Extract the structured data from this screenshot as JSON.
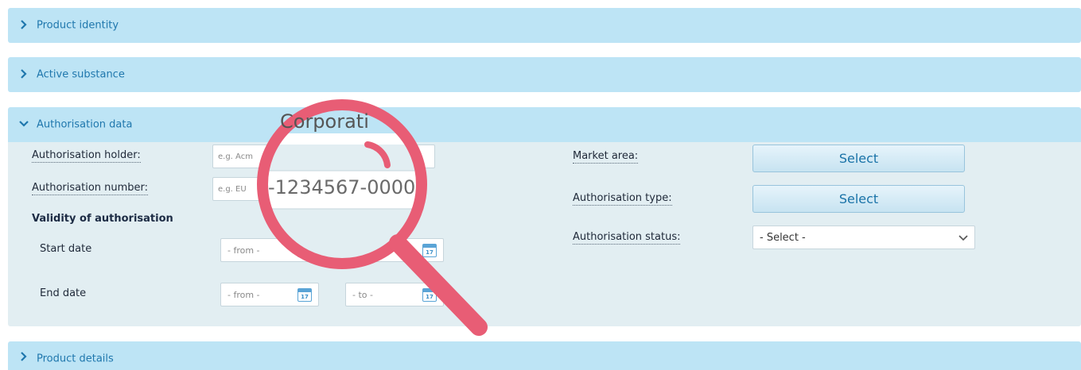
{
  "panels": {
    "product_identity": "Product identity",
    "active_substance": "Active substance",
    "authorisation_data": "Authorisation data",
    "product_details": "Product details"
  },
  "form": {
    "holder_label": "Authorisation holder:",
    "holder_placeholder": "e.g. Acm",
    "number_label": "Authorisation number:",
    "number_placeholder": "e.g. EU",
    "validity_heading": "Validity of authorisation",
    "start_date_label": "Start date",
    "end_date_label": "End date",
    "from_placeholder": "- from -",
    "to_placeholder": "- to -",
    "calendar_day": "17",
    "market_area_label": "Market area:",
    "market_area_button": "Select",
    "auth_type_label": "Authorisation type:",
    "auth_type_button": "Select",
    "auth_status_label": "Authorisation status:",
    "auth_status_value": "- Select -"
  },
  "magnifier": {
    "text_top": "Corporati",
    "text_bottom": "-1234567-0000"
  },
  "colors": {
    "header_bg": "#bde4f5",
    "body_bg": "#e2eef2",
    "link_blue": "#1f77ad",
    "magnifier": "#e85d75"
  }
}
